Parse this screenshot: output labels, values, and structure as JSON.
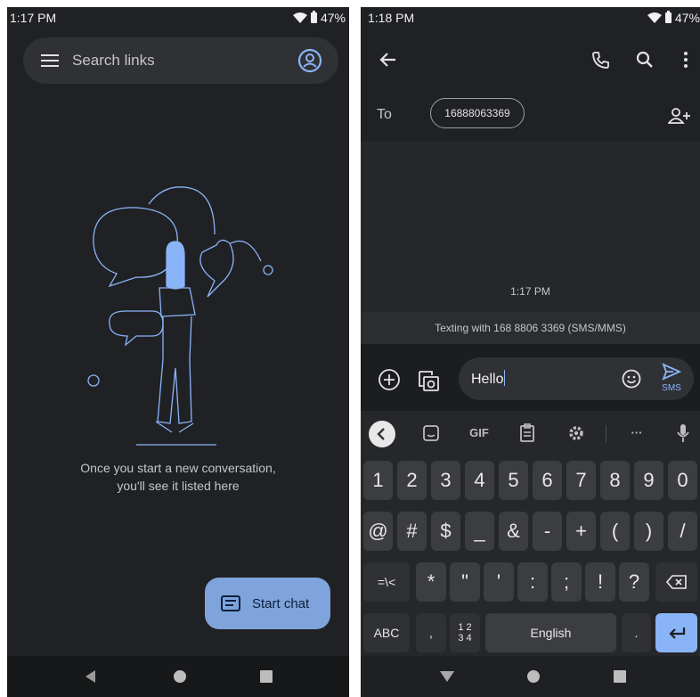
{
  "left": {
    "status": {
      "time": "1:17 PM",
      "battery": "47%"
    },
    "search": {
      "placeholder": "Search links"
    },
    "empty_state": {
      "line1": "Once you start a new conversation,",
      "line2": "you'll see it listed here"
    },
    "fab": {
      "label": "Start chat"
    }
  },
  "right": {
    "status": {
      "time": "1:18 PM",
      "battery": "47%"
    },
    "to": {
      "label": "To",
      "recipient": "16888063369"
    },
    "timestamp": "1:17 PM",
    "texting_info": "Texting with 168 8806 3369 (SMS/MMS)",
    "compose": {
      "text": "Hello",
      "send_label": "SMS"
    },
    "keyboard": {
      "toolbar": {
        "gif": "GIF",
        "more": "···"
      },
      "row1": [
        "1",
        "2",
        "3",
        "4",
        "5",
        "6",
        "7",
        "8",
        "9",
        "0"
      ],
      "row2": [
        "@",
        "#",
        "$",
        "_",
        "&",
        "-",
        "+",
        "(",
        ")",
        "/"
      ],
      "row3": [
        "=\\<",
        "*",
        "\"",
        "'",
        ":",
        ";",
        "!",
        "?"
      ],
      "row4": {
        "abc": "ABC",
        "comma": ",",
        "numpad_top": "1 2",
        "numpad_bottom": "3 4",
        "space": "English",
        "period": "."
      }
    }
  },
  "colors": {
    "background": "#202124",
    "accent": "#8ab4f8",
    "fab": "#7fa4dc"
  }
}
